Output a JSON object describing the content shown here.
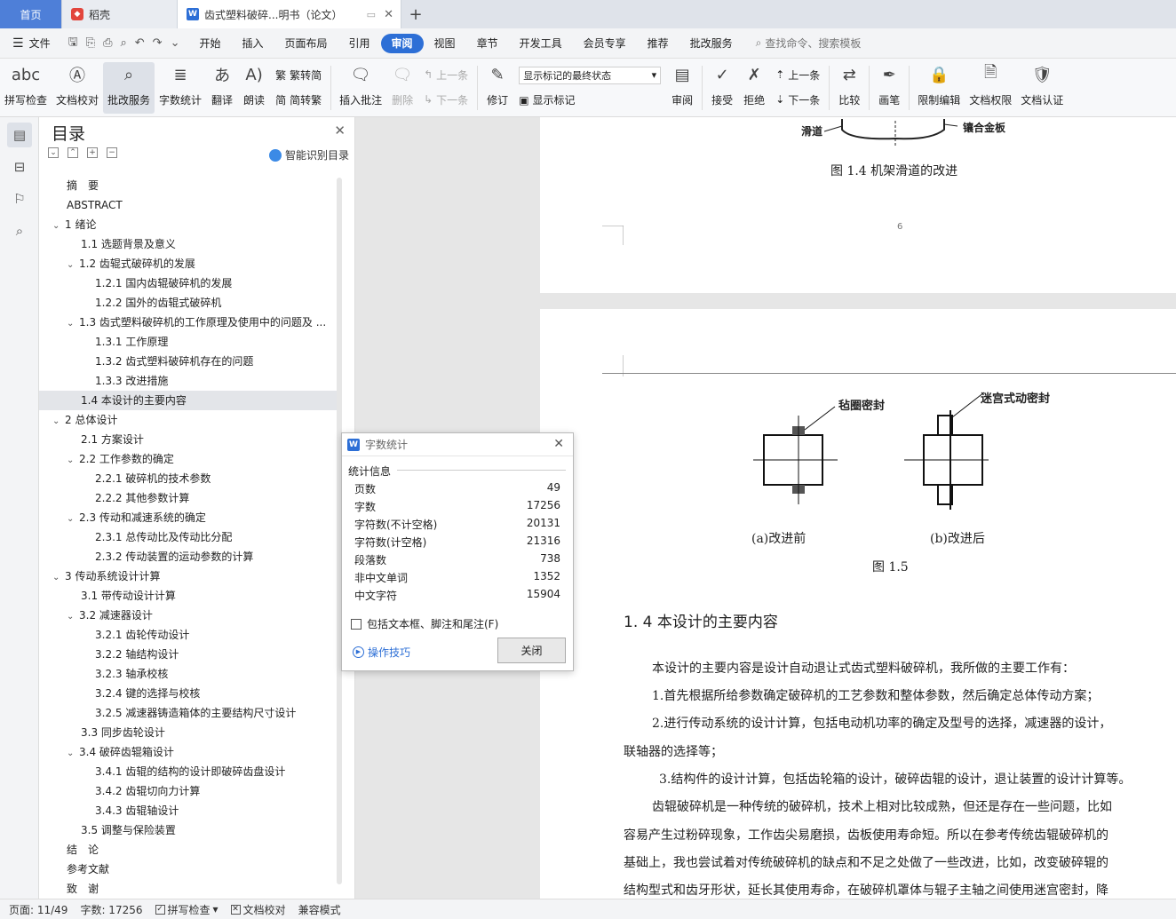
{
  "tabs": {
    "home": "首页",
    "daoke": "稻壳",
    "doc": "齿式塑料破碎...明书（论文）"
  },
  "menu": {
    "file": "文件",
    "items": [
      "开始",
      "插入",
      "页面布局",
      "引用",
      "审阅",
      "视图",
      "章节",
      "开发工具",
      "会员专享",
      "推荐",
      "批改服务"
    ],
    "active": "审阅",
    "search": "查找命令、搜索模板"
  },
  "ribbon": {
    "spell": "拼写检查",
    "proof": "文档校对",
    "review_service": "批改服务",
    "wordcount": "字数统计",
    "translate": "翻译",
    "read": "朗读",
    "trad": "繁转简",
    "simp": "简转繁",
    "insert_comment": "插入批注",
    "delete": "删除",
    "prev": "上一条",
    "next": "下一条",
    "track": "修订",
    "markup_state": "显示标记的最终状态",
    "show_markup": "显示标记",
    "review": "审阅",
    "accept": "接受",
    "reject": "拒绝",
    "prev2": "上一条",
    "next2": "下一条",
    "compare": "比较",
    "pen": "画笔",
    "restrict": "限制编辑",
    "perm": "文档权限",
    "cert": "文档认证"
  },
  "toc": {
    "title": "目录",
    "smart": "智能识别目录",
    "items": [
      {
        "label": "摘　要",
        "level": 0
      },
      {
        "label": "ABSTRACT",
        "level": 0
      },
      {
        "label": "1  绪论",
        "level": 0,
        "caret": true
      },
      {
        "label": "1.1 选题背景及意义",
        "level": 1
      },
      {
        "label": "1.2 齿辊式破碎机的发展",
        "level": 1,
        "caret": true
      },
      {
        "label": "1.2.1 国内齿辊破碎机的发展",
        "level": 2
      },
      {
        "label": "1.2.2 国外的齿辊式破碎机",
        "level": 2
      },
      {
        "label": "1.3 齿式塑料破碎机的工作原理及使用中的问题及 ...",
        "level": 1,
        "caret": true
      },
      {
        "label": "1.3.1 工作原理",
        "level": 2
      },
      {
        "label": "1.3.2 齿式塑料破碎机存在的问题",
        "level": 2
      },
      {
        "label": "1.3.3 改进措施",
        "level": 2
      },
      {
        "label": "1.4 本设计的主要内容",
        "level": 1,
        "selected": true
      },
      {
        "label": "2  总体设计",
        "level": 0,
        "caret": true
      },
      {
        "label": "2.1 方案设计",
        "level": 1
      },
      {
        "label": "2.2 工作参数的确定",
        "level": 1,
        "caret": true
      },
      {
        "label": "2.2.1 破碎机的技术参数",
        "level": 2
      },
      {
        "label": "2.2.2 其他参数计算",
        "level": 2
      },
      {
        "label": "2.3 传动和减速系统的确定",
        "level": 1,
        "caret": true
      },
      {
        "label": "2.3.1 总传动比及传动比分配",
        "level": 2
      },
      {
        "label": "2.3.2 传动装置的运动参数的计算",
        "level": 2
      },
      {
        "label": "3  传动系统设计计算",
        "level": 0,
        "caret": true
      },
      {
        "label": "3.1  带传动设计计算",
        "level": 1
      },
      {
        "label": "3.2 减速器设计",
        "level": 1,
        "caret": true
      },
      {
        "label": "3.2.1 齿轮传动设计",
        "level": 2
      },
      {
        "label": "3.2.2 轴结构设计",
        "level": 2
      },
      {
        "label": "3.2.3 轴承校核",
        "level": 2
      },
      {
        "label": "3.2.4 键的选择与校核",
        "level": 2
      },
      {
        "label": "3.2.5 减速器铸造箱体的主要结构尺寸设计",
        "level": 2
      },
      {
        "label": "3.3 同步齿轮设计",
        "level": 1
      },
      {
        "label": "3.4 破碎齿辊箱设计",
        "level": 1,
        "caret": true
      },
      {
        "label": "3.4.1 齿辊的结构的设计即破碎齿盘设计",
        "level": 2
      },
      {
        "label": "3.4.2 齿辊切向力计算",
        "level": 2
      },
      {
        "label": "3.4.3 齿辊轴设计",
        "level": 2
      },
      {
        "label": "3.5 调整与保险装置",
        "level": 1
      },
      {
        "label": "结　论",
        "level": 0
      },
      {
        "label": "参考文献",
        "level": 0
      },
      {
        "label": "致　谢",
        "level": 0
      }
    ]
  },
  "document": {
    "fig14_label_left": "滑道",
    "fig14_label_right": "镶合金板",
    "fig14_caption": "图 1.4 机架滑道的改进",
    "page_number": "6",
    "fig15_label_a": "毡圈密封",
    "fig15_label_b": "迷宫式动密封",
    "fig15_sub_a": "(a)改进前",
    "fig15_sub_b": "(b)改进后",
    "fig15_caption": "图 1.5",
    "heading": "1. 4 本设计的主要内容",
    "paragraphs": [
      "本设计的主要内容是设计自动退让式齿式塑料破碎机，我所做的主要工作有：",
      "1.首先根据所给参数确定破碎机的工艺参数和整体参数，然后确定总体传动方案；",
      "2.进行传动系统的设计计算，包括电动机功率的确定及型号的选择，减速器的设计，",
      "联轴器的选择等；",
      "3.结构件的设计计算，包括齿轮箱的设计，破碎齿辊的设计，退让装置的设计计算等。",
      "齿辊破碎机是一种传统的破碎机，技术上相对比较成熟，但还是存在一些问题，比如",
      "容易产生过粉碎现象，工作齿尖易磨损，齿板使用寿命短。所以在参考传统齿辊破碎机的",
      "基础上，我也尝试着对传统破碎机的缺点和不足之处做了一些改进，比如，改变破碎辊的",
      "结构型式和齿牙形状，延长其使用寿命，在破碎机罩体与辊子主轴之间使用迷宫密封，降"
    ]
  },
  "dialog": {
    "title": "字数统计",
    "section": "统计信息",
    "rows": [
      {
        "label": "页数",
        "value": "49"
      },
      {
        "label": "字数",
        "value": "17256"
      },
      {
        "label": "字符数(不计空格)",
        "value": "20131"
      },
      {
        "label": "字符数(计空格)",
        "value": "21316"
      },
      {
        "label": "段落数",
        "value": "738"
      },
      {
        "label": "非中文单词",
        "value": "1352"
      },
      {
        "label": "中文字符",
        "value": "15904"
      }
    ],
    "checkbox": "包括文本框、脚注和尾注(F)",
    "tips": "操作技巧",
    "close": "关闭"
  },
  "status": {
    "page": "页面: 11/49",
    "words": "字数: 17256",
    "spell": "拼写检查",
    "proof": "文档校对",
    "compat": "兼容模式"
  }
}
